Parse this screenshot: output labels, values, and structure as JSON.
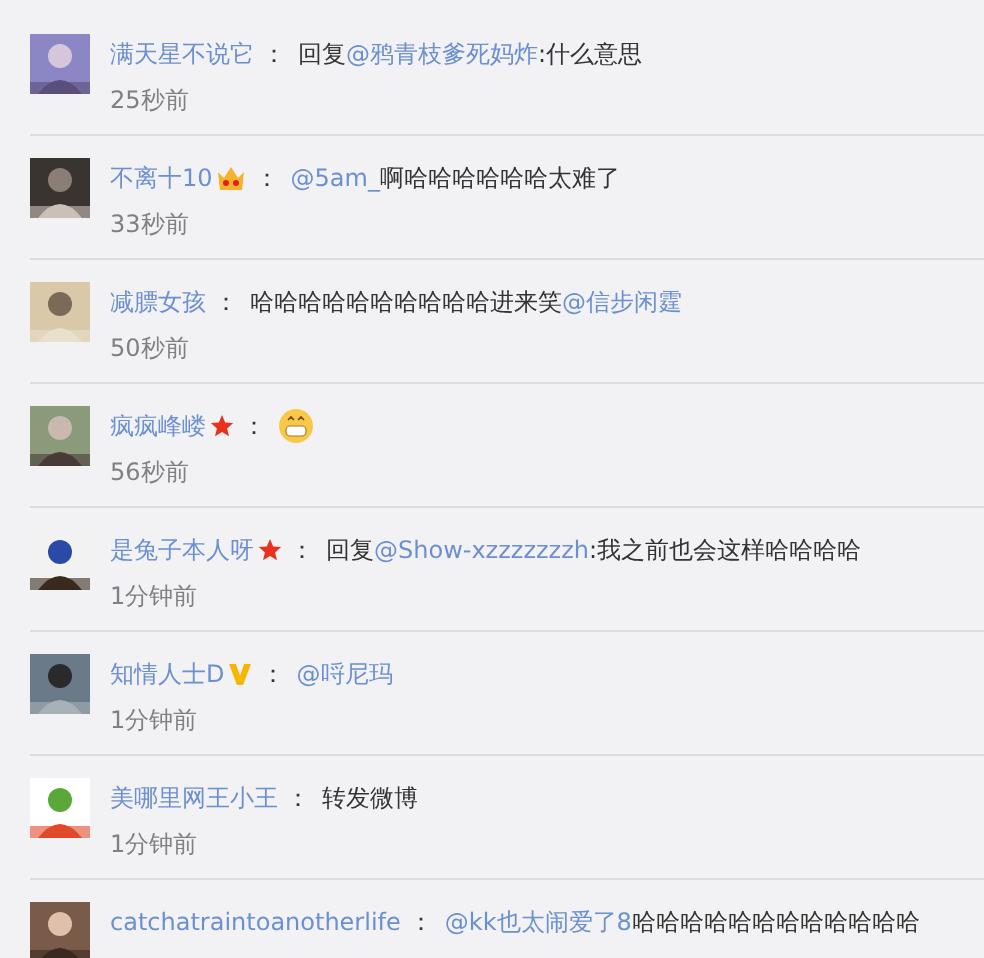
{
  "comments": [
    {
      "user": "满天星不说它",
      "separator": "：",
      "segments": [
        {
          "kind": "text",
          "text": "回复"
        },
        {
          "kind": "mention",
          "text": "@鸦青枝爹死妈炸"
        },
        {
          "kind": "text",
          "text": ":什么意思"
        }
      ],
      "time": "25秒前"
    },
    {
      "user": "不离十10",
      "badge": {
        "kind": "crown"
      },
      "separator": "：",
      "segments": [
        {
          "kind": "mention",
          "text": "@5am_"
        },
        {
          "kind": "text",
          "text": " 啊哈哈哈哈哈哈太难了"
        }
      ],
      "time": "33秒前"
    },
    {
      "user": "减膘女孩",
      "separator": "：",
      "segments": [
        {
          "kind": "text",
          "text": "哈哈哈哈哈哈哈哈哈哈进来笑"
        },
        {
          "kind": "mention",
          "text": "@信步闲霆"
        }
      ],
      "time": "50秒前"
    },
    {
      "user": "疯疯峰嵝",
      "badge": {
        "kind": "star"
      },
      "separator": "：",
      "segments": [
        {
          "kind": "emoji"
        }
      ],
      "time": "56秒前"
    },
    {
      "user": "是兔子本人呀",
      "badge": {
        "kind": "star"
      },
      "separator": "：",
      "segments": [
        {
          "kind": "text",
          "text": "回复"
        },
        {
          "kind": "mention",
          "text": "@Show-xzzzzzzzh"
        },
        {
          "kind": "text",
          "text": ":我之前也会这样哈哈哈哈"
        }
      ],
      "time": "1分钟前"
    },
    {
      "user": "知情人士D",
      "badge": {
        "kind": "v"
      },
      "separator": "：",
      "segments": [
        {
          "kind": "mention",
          "text": "@哷尼玛"
        }
      ],
      "time": "1分钟前"
    },
    {
      "user": "美哪里网王小王",
      "separator": "：",
      "segments": [
        {
          "kind": "text",
          "text": "转发微博"
        }
      ],
      "time": "1分钟前"
    },
    {
      "user": "catchatraintoanotherlife",
      "separator": "：",
      "segments": [
        {
          "kind": "mention",
          "text": "@kk也太闹爱了8"
        },
        {
          "kind": "text",
          "text": " 哈哈哈哈哈哈哈哈哈哈哈哈"
        }
      ]
    }
  ]
}
